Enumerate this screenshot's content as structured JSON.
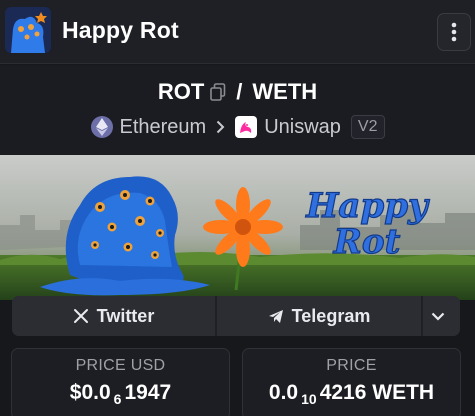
{
  "header": {
    "title": "Happy Rot",
    "logo_icon": "happy-rot-logo-icon",
    "menu_icon": "vertical-dots-icon"
  },
  "pair": {
    "base": "ROT",
    "separator": "/",
    "quote": "WETH",
    "copy_icon": "copy-icon"
  },
  "chain": {
    "network": "Ethereum",
    "dex": "Uniswap",
    "version": "V2"
  },
  "banner": {
    "text_line1": "Happy",
    "text_line2": "Rot"
  },
  "socials": {
    "twitter_label": "Twitter",
    "telegram_label": "Telegram",
    "more_icon": "chevron-down-icon"
  },
  "price_usd": {
    "label": "PRICE USD",
    "prefix": "$0.0",
    "zeros": "6",
    "digits": "1947"
  },
  "price_native": {
    "label": "PRICE",
    "prefix": "0.0",
    "zeros": "10",
    "digits": "4216 WETH"
  },
  "colors": {
    "background": "#17181c",
    "header": "#1f2026",
    "banner_text": "#2f6fe0",
    "ethereum": "#6c6fa8",
    "uniswap": "#ff2aa0"
  }
}
